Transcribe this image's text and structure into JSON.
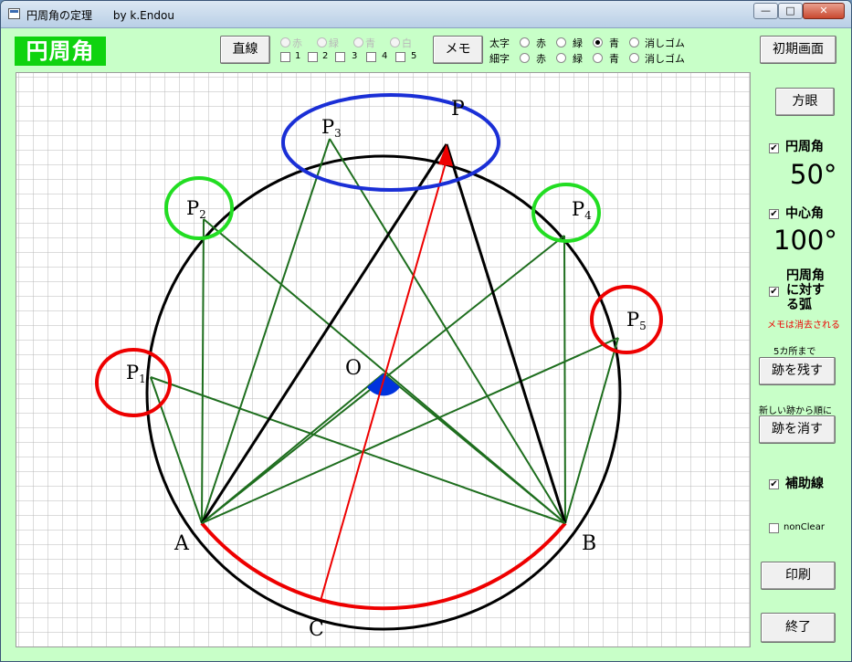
{
  "window": {
    "title": "円周角の定理      by k.Endou",
    "min_symbol": "—",
    "max_symbol": "□",
    "close_symbol": "✕"
  },
  "logo": "円周角",
  "toolbar": {
    "line_button": "直線",
    "line_colors": [
      "赤",
      "緑",
      "青",
      "白"
    ],
    "line_slots": [
      "1",
      "2",
      "3",
      "4",
      "5"
    ],
    "memo_button": "メモ",
    "thick_label": "太字",
    "thin_label": "細字",
    "pen_options": [
      "赤",
      "緑",
      "青",
      "消しゴム"
    ],
    "thick_selected": "青",
    "reset_button": "初期画面"
  },
  "sidebar": {
    "grid_button": "方眼",
    "inscribed_angle_label": "円周角",
    "inscribed_angle_value": "50°",
    "central_angle_label": "中心角",
    "central_angle_value": "100°",
    "arc_label": "円周角に対する弧",
    "arc_label_lines": [
      "円周角",
      "に対す",
      "る弧"
    ],
    "memo_warning": "メモは消去される",
    "trace_hint": "5カ所まで",
    "leave_trace_button": "跡を残す",
    "erase_hint": "新しい跡から順に",
    "erase_trace_button": "跡を消す",
    "aux_lines_label": "補助線",
    "nonclear_label": "nonClear",
    "print_button": "印刷",
    "exit_button": "終了",
    "check_mark": "✔"
  },
  "diagram": {
    "labels": {
      "P": "P",
      "P3": "P3",
      "P2": "P2",
      "P4": "P4",
      "P1": "P1",
      "P5": "P5",
      "O": "O",
      "A": "A",
      "B": "B",
      "C": "C"
    }
  }
}
